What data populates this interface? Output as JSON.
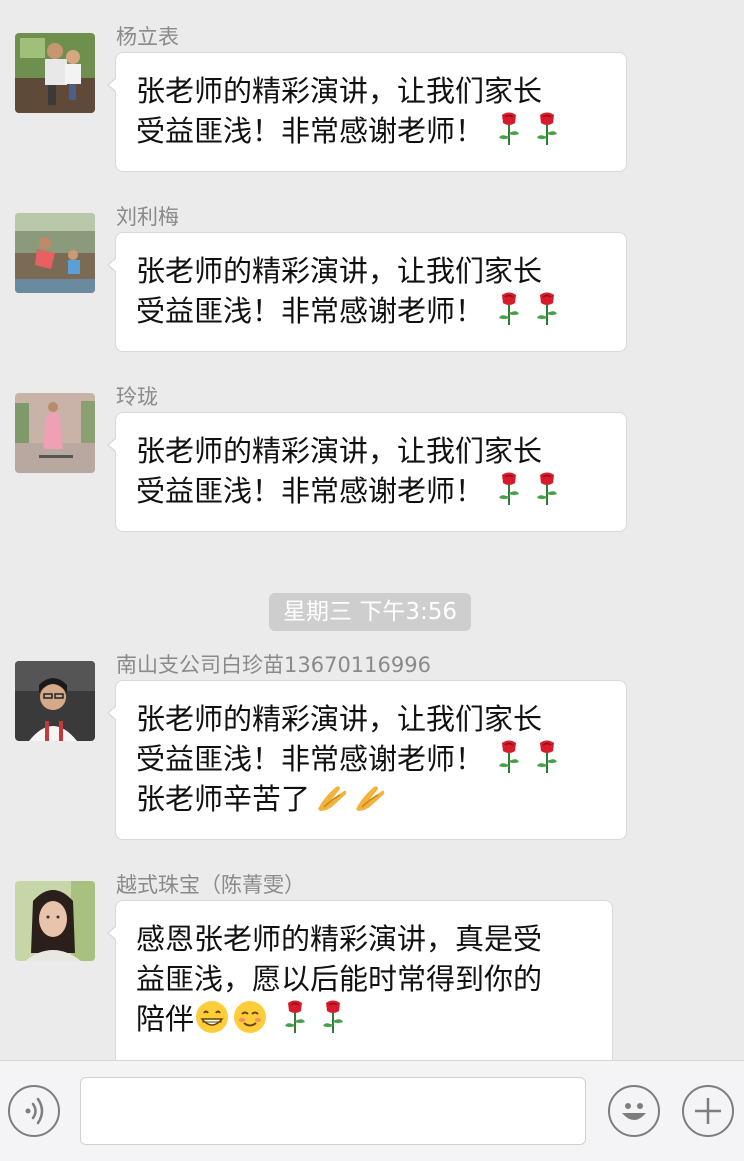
{
  "messages": [
    {
      "sender": "杨立表",
      "lines": [
        "张老师的精彩演讲，让我们家长",
        "受益匪浅！非常感谢老师！"
      ]
    },
    {
      "sender": "刘利梅",
      "lines": [
        "张老师的精彩演讲，让我们家长",
        "受益匪浅！非常感谢老师！"
      ]
    },
    {
      "sender": "玲珑",
      "lines": [
        "张老师的精彩演讲，让我们家长",
        "受益匪浅！非常感谢老师！"
      ]
    },
    {
      "sender": "南山支公司白珍苗13670116996",
      "lines": [
        "张老师的精彩演讲，让我们家长",
        "受益匪浅！非常感谢老师！",
        "张老师辛苦了"
      ]
    },
    {
      "sender": "越式珠宝（陈菁雯）",
      "lines": [
        "感恩张老师的精彩演讲，真是受",
        "益匪浅，愿以后能时常得到你的",
        "陪伴"
      ]
    }
  ],
  "timestamp": "星期三 下午3:56",
  "emoji": {
    "rose": "rose-emoji",
    "clap": "clapping-hands-emoji",
    "grin": "grinning-face-emoji",
    "smile": "smiling-face-emoji"
  },
  "input_bar": {
    "voice_icon": "voice-icon",
    "emoji_icon": "emoji-icon",
    "plus_icon": "plus-icon",
    "text_value": ""
  },
  "colors": {
    "background": "#ebebeb",
    "bubble": "#ffffff",
    "sender_name": "#8a8a8a",
    "timestamp_bg": "#cecece"
  }
}
